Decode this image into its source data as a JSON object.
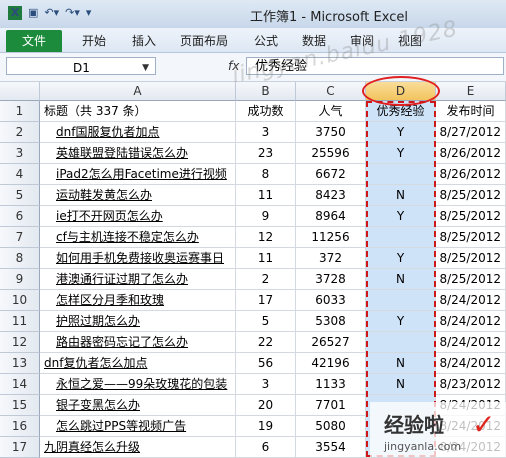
{
  "window": {
    "title": "工作簿1 - Microsoft Excel"
  },
  "ribbon": {
    "file": "文件",
    "tabs": [
      "开始",
      "插入",
      "页面布局",
      "公式",
      "数据",
      "审阅",
      "视图"
    ]
  },
  "formula_bar": {
    "name_box": "D1",
    "fx": "fx",
    "value": "优秀经验"
  },
  "columns": [
    "A",
    "B",
    "C",
    "D",
    "E"
  ],
  "header_row": [
    "标题（共 337 条）",
    "成功数",
    "人气",
    "优秀经验",
    "发布时间"
  ],
  "rows": [
    [
      "dnf国服复仇者加点",
      "3",
      "3750",
      "Y",
      "8/27/2012"
    ],
    [
      "英雄联盟登陆错误怎么办",
      "23",
      "25596",
      "Y",
      "8/26/2012"
    ],
    [
      "iPad2怎么用Facetime进行视频",
      "8",
      "6672",
      "",
      "8/26/2012"
    ],
    [
      "运动鞋发黄怎么办",
      "11",
      "8423",
      "N",
      "8/25/2012"
    ],
    [
      "ie打不开网页怎么办",
      "9",
      "8964",
      "Y",
      "8/25/2012"
    ],
    [
      "cf与主机连接不稳定怎么办",
      "12",
      "11256",
      "",
      "8/25/2012"
    ],
    [
      "如何用手机免费接收奥运赛事日",
      "11",
      "372",
      "Y",
      "8/25/2012"
    ],
    [
      "港澳通行证过期了怎么办",
      "2",
      "3728",
      "N",
      "8/25/2012"
    ],
    [
      "怎样区分月季和玫瑰",
      "17",
      "6033",
      "",
      "8/24/2012"
    ],
    [
      "护照过期怎么办",
      "5",
      "5308",
      "Y",
      "8/24/2012"
    ],
    [
      "路由器密码忘记了怎么办",
      "22",
      "26527",
      "",
      "8/24/2012"
    ],
    [
      "dnf复仇者怎么加点",
      "56",
      "42196",
      "N",
      "8/24/2012"
    ],
    [
      "永恒之爱——99朵玫瑰花的包装",
      "3",
      "1133",
      "N",
      "8/23/2012"
    ],
    [
      "银子变黑怎么办",
      "20",
      "7701",
      "",
      "8/24/2012"
    ],
    [
      "怎么跳过PPS等视频广告",
      "19",
      "5080",
      "",
      "8/24/2012"
    ],
    [
      "九阴真经怎么升级",
      "6",
      "3554",
      "",
      "8/24/2012"
    ]
  ],
  "row_numbers": [
    "1",
    "2",
    "3",
    "4",
    "5",
    "6",
    "7",
    "8",
    "9",
    "10",
    "11",
    "12",
    "13",
    "14",
    "15",
    "16",
    "17"
  ],
  "watermark": {
    "logo_text": "经验啦",
    "logo_url": "jingyanla.com"
  },
  "colors": {
    "file_tab": "#1d8b3c",
    "selection_fill": "#cfe3f8",
    "highlight_red": "#d01717"
  }
}
